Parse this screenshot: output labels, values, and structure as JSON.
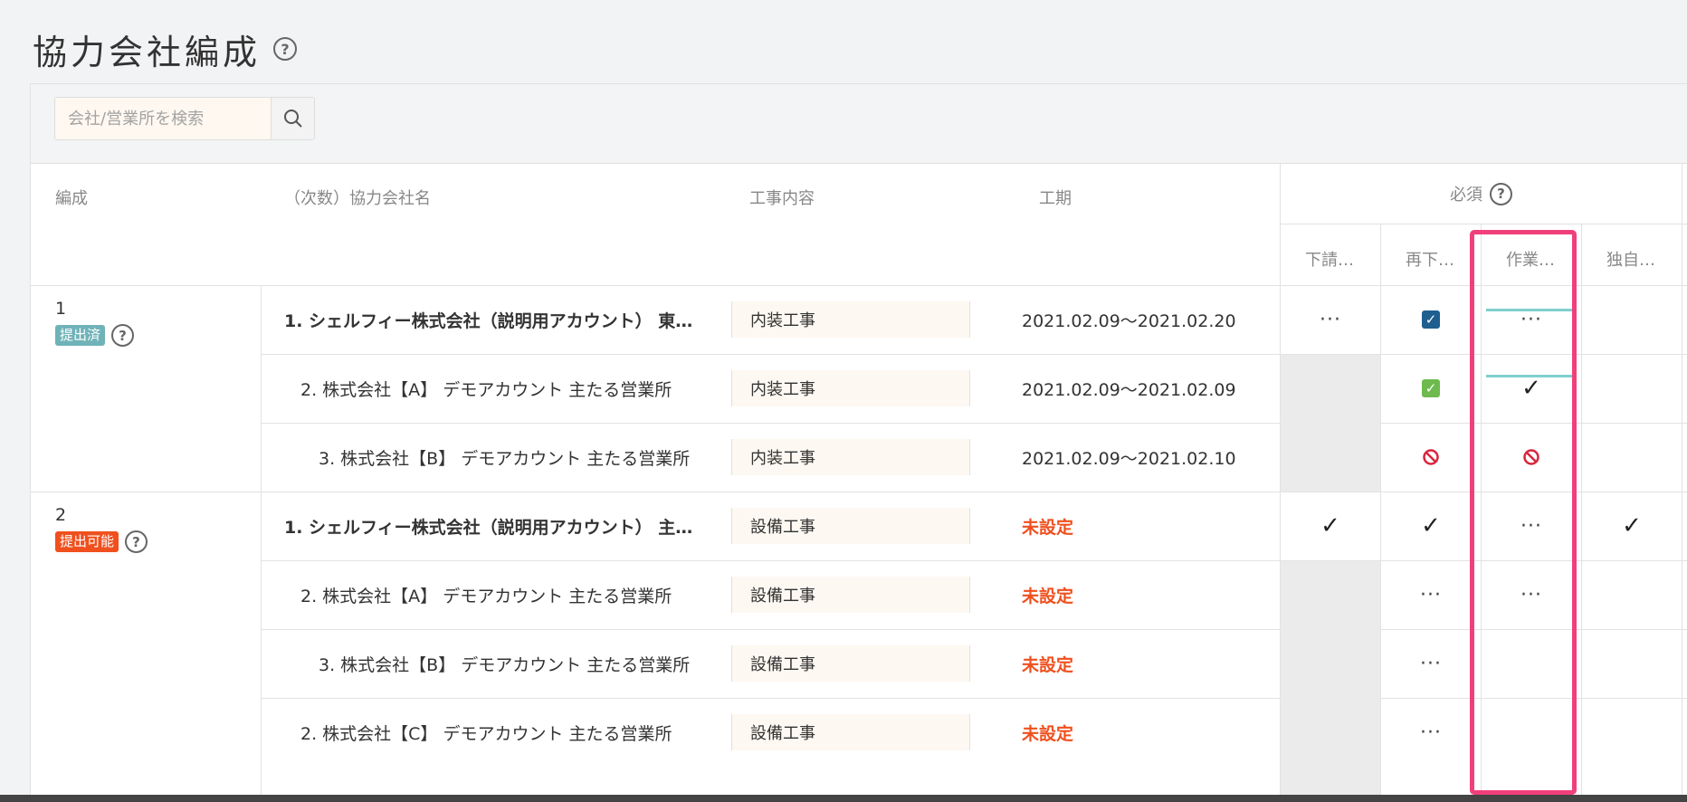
{
  "page": {
    "title": "協力会社編成",
    "help_symbol": "?"
  },
  "search": {
    "placeholder": "会社/営業所を検索",
    "button_icon": "search-icon"
  },
  "columns": {
    "formation": "編成",
    "company": "（次数）協力会社名",
    "work": "工事内容",
    "period": "工期",
    "required": "必須",
    "required_sub": [
      "下請…",
      "再下…",
      "作業…",
      "独自…"
    ]
  },
  "groups": [
    {
      "number": "1",
      "status": "提出済",
      "status_color": "#6fb3b8",
      "rows": [
        {
          "company": "1. シェルフィー株式会社（説明用アカウント） 東…",
          "bold": true,
          "work": "内装工事",
          "period": "2021.02.09～2021.02.20",
          "unset": false,
          "marks": [
            "dots",
            "checkbox-blue",
            "dots",
            ""
          ]
        },
        {
          "company": "2. 株式会社【A】 デモアカウント 主たる営業所",
          "bold": false,
          "work": "内装工事",
          "period": "2021.02.09～2021.02.09",
          "unset": false,
          "marks": [
            "gray",
            "checkbox-green",
            "check",
            ""
          ]
        },
        {
          "company": "3. 株式会社【B】 デモアカウント 主たる営業所",
          "bold": false,
          "work": "内装工事",
          "period": "2021.02.09～2021.02.10",
          "unset": false,
          "marks": [
            "gray",
            "prohibited",
            "prohibited",
            ""
          ]
        }
      ]
    },
    {
      "number": "2",
      "status": "提出可能",
      "status_color": "#f0501e",
      "rows": [
        {
          "company": "1. シェルフィー株式会社（説明用アカウント） 主…",
          "bold": true,
          "work": "設備工事",
          "period": "未設定",
          "unset": true,
          "marks": [
            "check",
            "check",
            "dots",
            "check"
          ]
        },
        {
          "company": "2. 株式会社【A】 デモアカウント 主たる営業所",
          "bold": false,
          "work": "設備工事",
          "period": "未設定",
          "unset": true,
          "marks": [
            "gray",
            "dots",
            "dots",
            ""
          ]
        },
        {
          "company": "3. 株式会社【B】 デモアカウント 主たる営業所",
          "bold": false,
          "work": "設備工事",
          "period": "未設定",
          "unset": true,
          "marks": [
            "gray",
            "dots",
            "",
            ""
          ]
        },
        {
          "company": "2. 株式会社【C】 デモアカウント 主たる営業所",
          "bold": false,
          "work": "設備工事",
          "period": "未設定",
          "unset": true,
          "marks": [
            "gray",
            "dots",
            "",
            ""
          ]
        }
      ]
    }
  ],
  "symbols": {
    "dots": "···",
    "check": "✓",
    "checkbox_mark": "✓",
    "prohibited_color": "#d9263f",
    "checkbox_blue_color": "#1f5f8f",
    "checkbox_green_color": "#6fba4f"
  }
}
